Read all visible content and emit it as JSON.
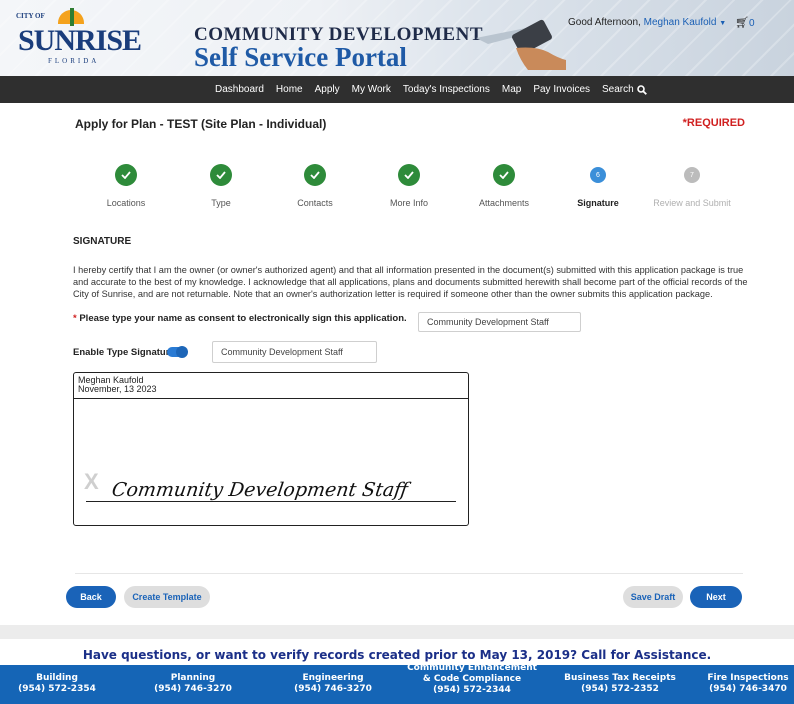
{
  "header": {
    "logo": {
      "city_of": "CITY OF",
      "name": "SUNRISE",
      "state": "FLORIDA"
    },
    "title_line1": "COMMUNITY DEVELOPMENT",
    "title_line2": "Self Service Portal",
    "greeting": "Good Afternoon,",
    "user_name": "Meghan Kaufold",
    "cart_count": "0"
  },
  "nav": {
    "items": [
      "Dashboard",
      "Home",
      "Apply",
      "My Work",
      "Today's Inspections",
      "Map",
      "Pay Invoices",
      "Search"
    ]
  },
  "page": {
    "title": "Apply for Plan - TEST (Site Plan - Individual)",
    "required_label": "*REQUIRED"
  },
  "steps": [
    {
      "label": "Locations",
      "state": "done"
    },
    {
      "label": "Type",
      "state": "done"
    },
    {
      "label": "Contacts",
      "state": "done"
    },
    {
      "label": "More Info",
      "state": "done"
    },
    {
      "label": "Attachments",
      "state": "done"
    },
    {
      "label": "Signature",
      "state": "active",
      "number": "6"
    },
    {
      "label": "Review and Submit",
      "state": "todo",
      "number": "7"
    }
  ],
  "signature": {
    "section_title": "SIGNATURE",
    "certification": "I hereby certify that I am the owner (or owner's authorized agent) and that all information presented in the document(s) submitted with this application package is true and accurate to the best of my knowledge. I acknowledge that all applications, plans and documents submitted herewith shall become part of the official records of the City of Sunrise, and are not returnable. Note that an owner's authorization letter is required if someone other than the owner submits this application package.",
    "consent_label": "Please type your name as consent to electronically sign this application.",
    "consent_value": "Community Development Staff",
    "enable_type_label": "Enable Type Signature",
    "enable_type_on": true,
    "type_value": "Community Development Staff",
    "box_name": "Meghan Kaufold",
    "box_date": "November, 13 2023",
    "box_x": "X",
    "signed_text": "Community Development Staff"
  },
  "buttons": {
    "back": "Back",
    "create_template": "Create Template",
    "save_draft": "Save Draft",
    "next": "Next"
  },
  "footer": {
    "help": "Have questions, or want to verify records created prior to May 13, 2019? Call for Assistance.",
    "contacts": [
      {
        "dept": "Building",
        "phone": "(954) 572-2354"
      },
      {
        "dept": "Planning",
        "phone": "(954) 746-3270"
      },
      {
        "dept": "Engineering",
        "phone": "(954) 746-3270"
      },
      {
        "dept": "Community Enhancement & Code Compliance",
        "phone": "(954) 572-2344"
      },
      {
        "dept": "Business Tax Receipts",
        "phone": "(954) 572-2352"
      },
      {
        "dept": "Fire Inspections",
        "phone": "(954) 746-3470"
      }
    ]
  },
  "colors": {
    "primary": "#1a63b8",
    "nav_bg": "#2f2f2f",
    "step_done": "#2e8b3a",
    "step_active": "#3b8fd9",
    "step_todo": "#bcbcbc",
    "footer_bar": "#1565b6",
    "help_text": "#1b2f88"
  }
}
